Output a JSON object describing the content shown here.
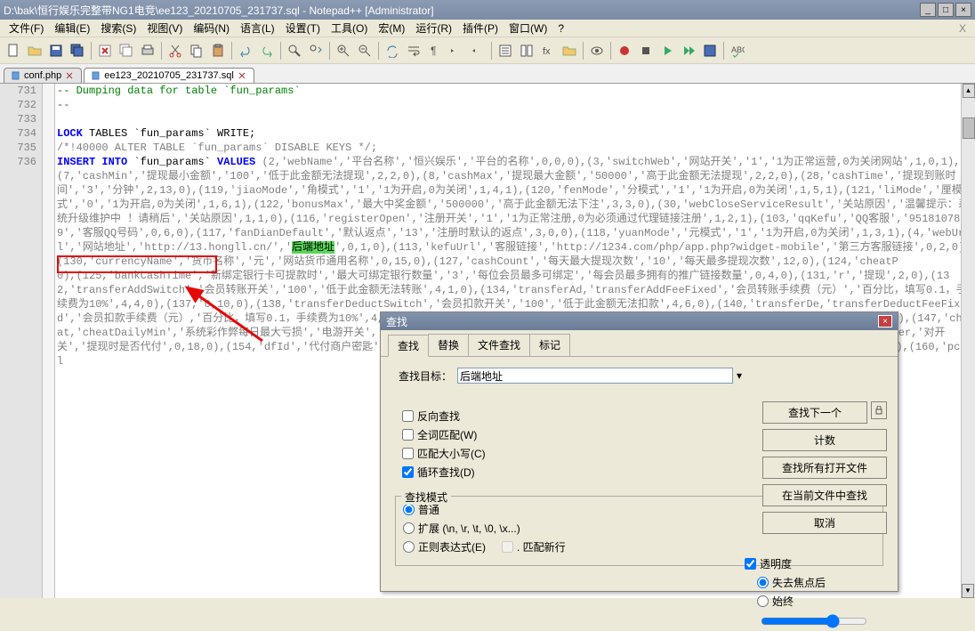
{
  "titlebar": {
    "text": "D:\\bak\\恒行娱乐完整带NG1电竞\\ee123_20210705_231737.sql - Notepad++ [Administrator]",
    "min": "_",
    "max": "□",
    "close": "×"
  },
  "menu": {
    "items": [
      "文件(F)",
      "编辑(E)",
      "搜索(S)",
      "视图(V)",
      "编码(N)",
      "语言(L)",
      "设置(T)",
      "工具(O)",
      "宏(M)",
      "运行(R)",
      "插件(P)",
      "窗口(W)",
      "?"
    ],
    "x": "X"
  },
  "tabs": [
    {
      "label": "conf.php",
      "active": false
    },
    {
      "label": "ee123_20210705_231737.sql",
      "active": true
    }
  ],
  "gutter": [
    "731",
    "732",
    "733",
    "734",
    "735",
    "736"
  ],
  "code": {
    "l731": "-- Dumping data for table `fun_params`",
    "l732": "--",
    "l733": "",
    "l734_kw": "LOCK",
    "l734_rest": " TABLES `fun_params` WRITE;",
    "l735": "/*!40000 ALTER TABLE `fun_params` DISABLE KEYS */;",
    "l736_kw": "INSERT INTO",
    "l736_rest": " `fun_params` ",
    "l736_kw2": "VALUES",
    "body": " (2,'webName','平台名称','恒兴娱乐','平台的名称',0,0,0),(3,'switchWeb','网站开关','1','1为正常运营,0为关闭网站',1,0,1),(7,'cashMin','提现最小金额','100','低于此金额无法提现',2,2,0),(8,'cashMax','提现最大金额','50000','高于此金额无法提现',2,2,0),(28,'cashTime','提现到账时间','3','分钟',2,13,0),(119,'jiaoMode','角模式','1','1为开启,0为关闭',1,4,1),(120,'fenMode','分模式','1','1为开启,0为关闭',1,5,1),(121,'liMode','厘模式','0','1为开启,0为关闭',1,6,1),(122,'bonusMax','最大中奖金额','500000','高于此金额无法下注',3,3,0),(30,'webCloseServiceResult','关站原因','温馨提示：系统升级维护中 ！请稍后','关站原因',1,1,0),(116,'registerOpen','注册开关','1','1为正常注册,0为必须通过代理链接注册',1,2,1),(103,'qqKefu','QQ客服','951810789','客服QQ号码',0,6,0),(117,'fanDianDefault','默认返点','13','注册时默认的返点',3,0,0),(118,'yuanMode','元模式','1','1为开启,0为关闭',1,3,1),(4,'webUrl','网站地址','http://13.hongll.cn/','",
    "hlword": "后端地址",
    "body2": "',0,1,0),(113,'kefuUrl','客服链接','http://1234.com/php/app.php?widget-mobile','第三方客服链接',0,2,0),(130,'currencyName','货币名称','元','网站货币通用名称',0,15,0),(127,'cashCount','每天最大提现次数','10','每天最多提现次数',12,0),(124,'cheatP",
    "body3": "0),(125,'bankCashTime','新绑定银行卡可提款时','最大可绑定银行数量','3','每位会员最多可绑定','每会员最多拥有的推广链接数量',0,4,0),(131,'r','提现',2,0),(132,'transferAddSwitch','会员转账开关','100','低于此金额无法转账',4,1,0),(134,'transferAd,'transferAddFeeFixed','会员转账手续费（元）','百分比，填写0.1，手续费为10%',4,4,0),(137,'0,10,0),(138,'transferDeductSwitch','会员扣款开关','100','低于此金额无法扣款',4,6,0),(140,'transferDe,'transferDeductFeeFixed','会员扣款手续费（元）,'百分比，填写0.1，手续费为10%',4,9,0),(143,'lotteryFavoriteMax','彩票收藏最大数','16','注册时,1为必须,0为不必须',0,17,0),(147,'cheat,'cheatDailyMin','系统彩作弊每日最大亏损','电游开关','0','1为开户,0为关闭',1,2,1),(150,'r开关','1','1为开户,0为关闭',1,2,1),(152,'cheatLotter,'对开关','提现时是否代付',0,18,0),(154,'dfId','代付商户密匙',0,8,0),(156,'cashFeeFixed','费（%）','填写0.01就是1%',0,10,0),(158,'minFandia',0,0),(160,'pcUrl"
  },
  "dialog": {
    "title": "查找",
    "tabs": [
      "查找",
      "替换",
      "文件查找",
      "标记"
    ],
    "target_label": "查找目标：",
    "target_value": "后端地址",
    "opts": {
      "reverse": "反向查找",
      "whole": "全词匹配(W)",
      "case": "匹配大小写(C)",
      "loop": "循环查找(D)"
    },
    "mode_title": "查找模式",
    "modes": {
      "normal": "普通",
      "ext": "扩展 (\\n, \\r, \\t, \\0, \\x...)",
      "regex": "正则表达式(E)",
      "newline": ". 匹配新行"
    },
    "trans_title": "透明度",
    "trans": {
      "on_focus": "失去焦点后",
      "always": "始终"
    },
    "btns": {
      "next": "查找下一个",
      "count": "计数",
      "allopen": "查找所有打开文件",
      "current": "在当前文件中查找",
      "cancel": "取消"
    }
  }
}
